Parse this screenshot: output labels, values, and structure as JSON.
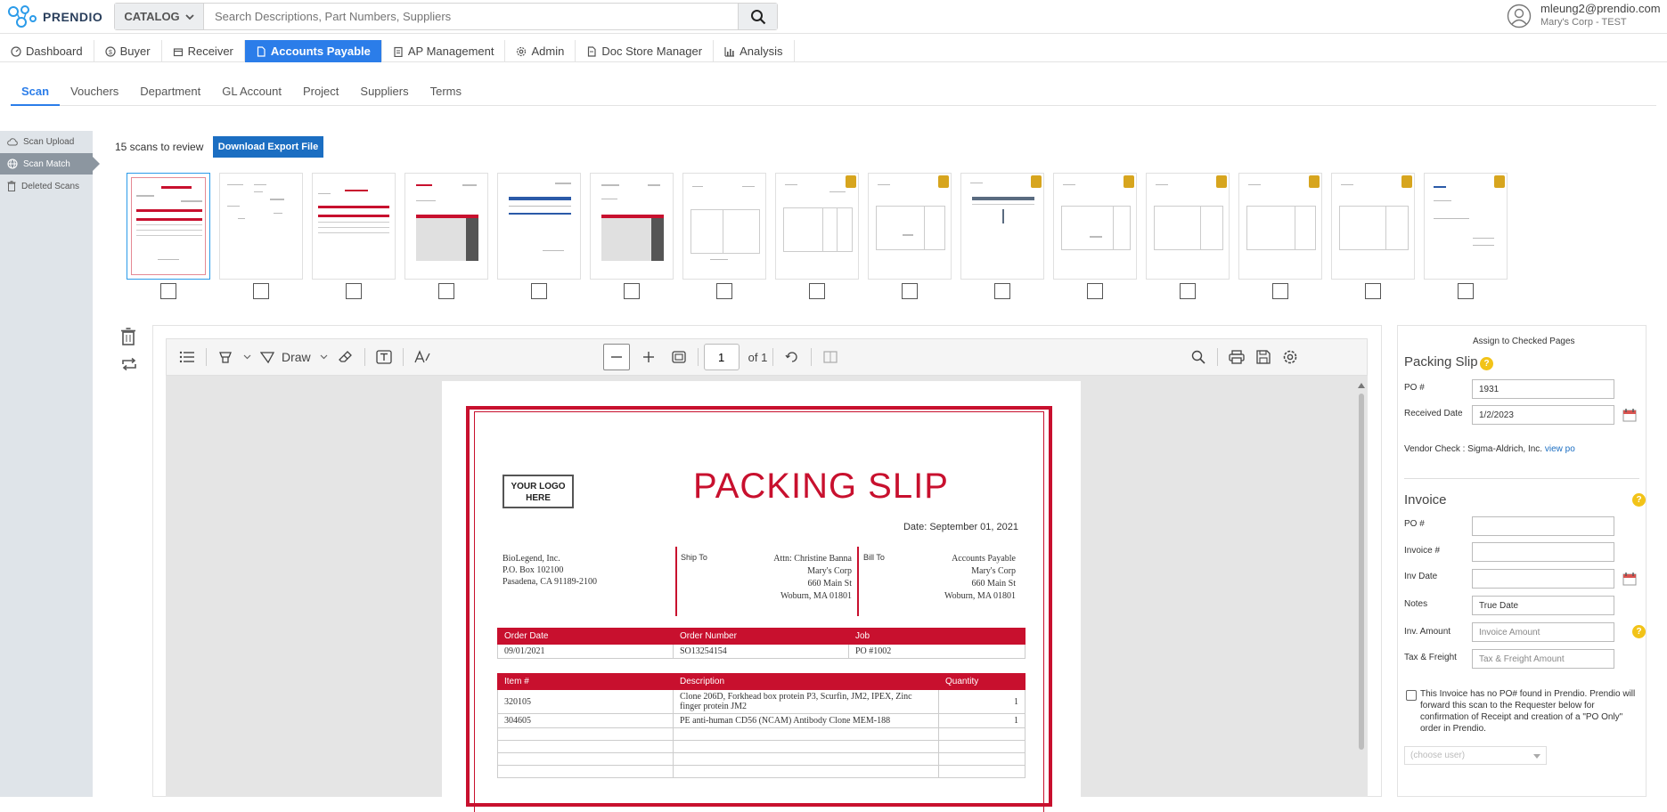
{
  "header": {
    "logo_text": "PRENDIO",
    "catalog_label": "CATALOG",
    "search_placeholder": "Search Descriptions, Part Numbers, Suppliers",
    "user_email": "mleung2@prendio.com",
    "user_org": "Mary's Corp - TEST"
  },
  "mainnav": [
    {
      "label": "Dashboard",
      "icon": "dashboard-icon"
    },
    {
      "label": "Buyer",
      "icon": "dollar-icon"
    },
    {
      "label": "Receiver",
      "icon": "box-icon"
    },
    {
      "label": "Accounts Payable",
      "icon": "document-icon",
      "active": true
    },
    {
      "label": "AP Management",
      "icon": "clipboard-icon"
    },
    {
      "label": "Admin",
      "icon": "gear-icon"
    },
    {
      "label": "Doc Store Manager",
      "icon": "doc-store-icon"
    },
    {
      "label": "Analysis",
      "icon": "bar-chart-icon"
    }
  ],
  "subnav": [
    "Scan",
    "Vouchers",
    "Department",
    "GL Account",
    "Project",
    "Suppliers",
    "Terms"
  ],
  "sidebar": [
    {
      "label": "Scan Upload",
      "icon": "cloud-upload-icon"
    },
    {
      "label": "Scan Match",
      "icon": "globe-icon",
      "active": true
    },
    {
      "label": "Deleted Scans",
      "icon": "trash-icon"
    }
  ],
  "scans": {
    "count_text": "15 scans to review",
    "download_label": "Download Export File"
  },
  "viewer": {
    "draw_label": "Draw",
    "page_value": "1",
    "page_of": "of 1"
  },
  "document": {
    "logo_text": "YOUR LOGO HERE",
    "title": "PACKING SLIP",
    "date": "Date: September 01, 2021",
    "from_lines": [
      "BioLegend, Inc.",
      "P.O. Box 102100",
      "Pasadena, CA 91189-2100"
    ],
    "ship_to_label": "Ship To",
    "ship_to_lines": [
      "Attn: Christine Banna",
      "Mary's Corp",
      "660 Main St",
      "Woburn, MA 01801"
    ],
    "bill_to_label": "Bill To",
    "bill_to_lines": [
      "Accounts Payable",
      "Mary's Corp",
      "660 Main St",
      "Woburn, MA 01801"
    ],
    "order_headers": [
      "Order Date",
      "Order Number",
      "Job"
    ],
    "order_row": [
      "09/01/2021",
      "SO13254154",
      "PO #1002"
    ],
    "item_headers": [
      "Item #",
      "Description",
      "Quantity"
    ],
    "items": [
      [
        "320105",
        "Clone 206D, Forkhead box protein P3, Scurfin, JM2, IPEX, Zinc finger protein JM2",
        "1"
      ],
      [
        "304605",
        "PE anti-human CD56 (NCAM) Antibody Clone MEM-188",
        "1"
      ]
    ]
  },
  "right_panel": {
    "assign_label": "Assign to Checked Pages",
    "packing_slip_title": "Packing Slip",
    "po_label": "PO #",
    "po_value": "1931",
    "received_date_label": "Received Date",
    "received_date_value": "1/2/2023",
    "vendor_check": "Vendor Check : Sigma-Aldrich, Inc.",
    "view_po_link": "view po",
    "invoice_title": "Invoice",
    "inv_po_label": "PO #",
    "invoice_num_label": "Invoice #",
    "inv_date_label": "Inv Date",
    "notes_label": "Notes",
    "notes_value": "True Date",
    "inv_amount_label": "Inv. Amount",
    "inv_amount_placeholder": "Invoice Amount",
    "tax_label": "Tax & Freight",
    "tax_placeholder": "Tax & Freight Amount",
    "no_po_notice": "This Invoice has no PO# found in Prendio. Prendio will forward this scan to the Requester below for confirmation of Receipt and creation of a \"PO Only\" order in Prendio.",
    "select_placeholder": "(choose user)"
  },
  "colors": {
    "accent": "#2b7de9",
    "brand_red": "#c8102e",
    "button_blue": "#1b6ec2",
    "help_yellow": "#f2c318"
  }
}
